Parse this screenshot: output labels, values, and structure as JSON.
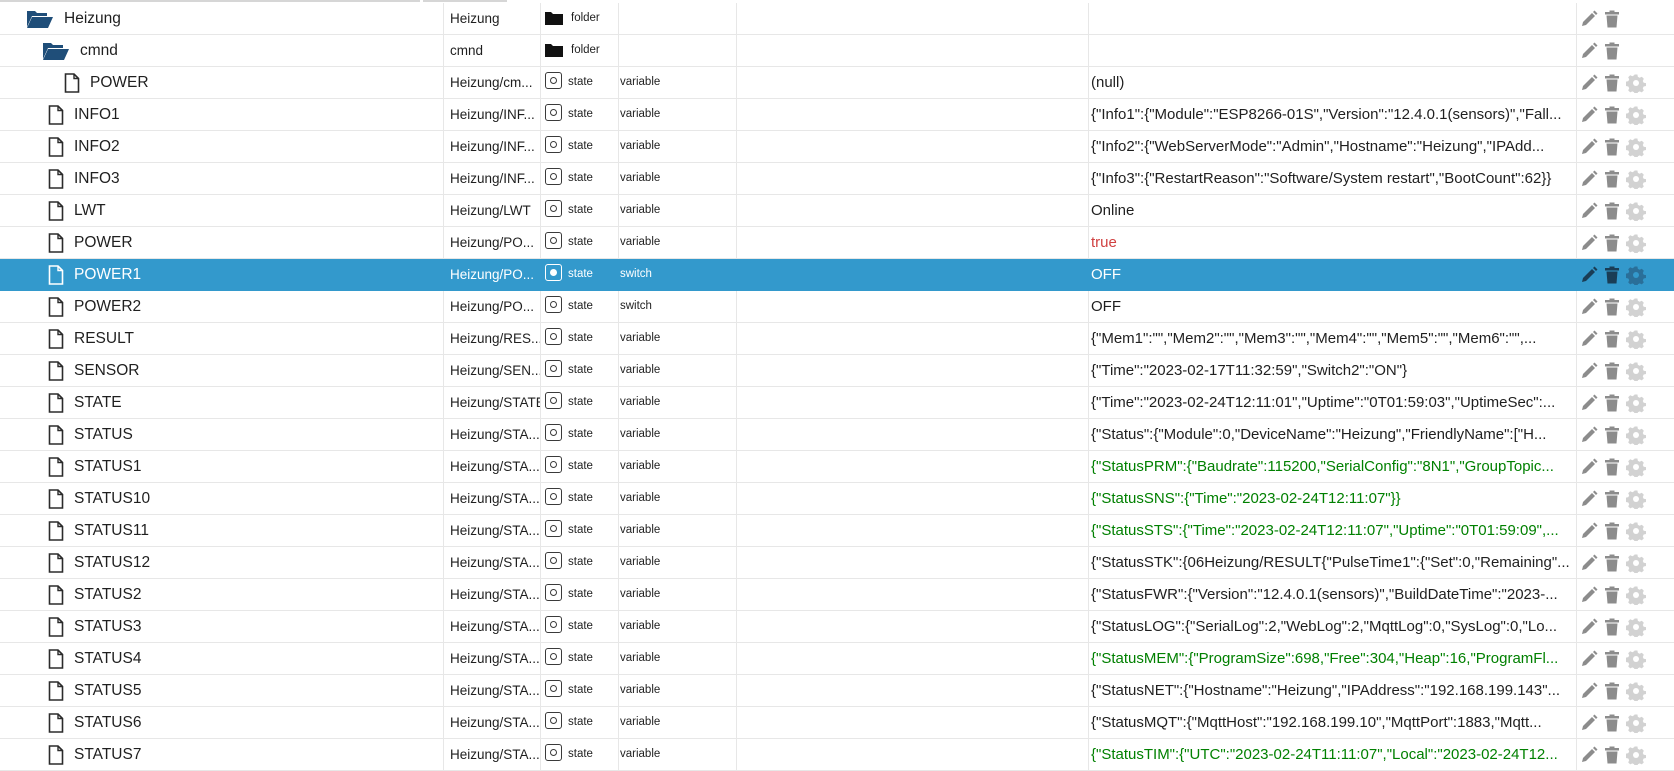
{
  "tree": {
    "rows": [
      {
        "name": "Heizung",
        "path": "Heizung",
        "type": "folder",
        "role": "",
        "value": "",
        "kind": "folder",
        "indent": 26,
        "value_color": "normal",
        "selected": false,
        "gear": false
      },
      {
        "name": "cmnd",
        "path": "cmnd",
        "type": "folder",
        "role": "",
        "value": "",
        "kind": "folder",
        "indent": 42,
        "value_color": "normal",
        "selected": false,
        "gear": false
      },
      {
        "name": "POWER",
        "path": "Heizung/cm...",
        "type": "state",
        "role": "variable",
        "value": "(null)",
        "kind": "file",
        "indent": 64,
        "value_color": "normal",
        "selected": false,
        "gear": true
      },
      {
        "name": "INFO1",
        "path": "Heizung/INF...",
        "type": "state",
        "role": "variable",
        "value": "{\"Info1\":{\"Module\":\"ESP8266-01S\",\"Version\":\"12.4.0.1(sensors)\",\"Fall...",
        "kind": "file",
        "indent": 48,
        "value_color": "normal",
        "selected": false,
        "gear": true
      },
      {
        "name": "INFO2",
        "path": "Heizung/INF...",
        "type": "state",
        "role": "variable",
        "value": "{\"Info2\":{\"WebServerMode\":\"Admin\",\"Hostname\":\"Heizung\",\"IPAdd...",
        "kind": "file",
        "indent": 48,
        "value_color": "normal",
        "selected": false,
        "gear": true
      },
      {
        "name": "INFO3",
        "path": "Heizung/INF...",
        "type": "state",
        "role": "variable",
        "value": "{\"Info3\":{\"RestartReason\":\"Software/System restart\",\"BootCount\":62}}",
        "kind": "file",
        "indent": 48,
        "value_color": "normal",
        "selected": false,
        "gear": true
      },
      {
        "name": "LWT",
        "path": "Heizung/LWT",
        "type": "state",
        "role": "variable",
        "value": "Online",
        "kind": "file",
        "indent": 48,
        "value_color": "normal",
        "selected": false,
        "gear": true
      },
      {
        "name": "POWER",
        "path": "Heizung/PO...",
        "type": "state",
        "role": "variable",
        "value": "true",
        "kind": "file",
        "indent": 48,
        "value_color": "red",
        "selected": false,
        "gear": true
      },
      {
        "name": "POWER1",
        "path": "Heizung/PO...",
        "type": "state",
        "role": "switch",
        "value": "OFF",
        "kind": "file",
        "indent": 48,
        "value_color": "normal",
        "selected": true,
        "gear": true
      },
      {
        "name": "POWER2",
        "path": "Heizung/PO...",
        "type": "state",
        "role": "switch",
        "value": "OFF",
        "kind": "file",
        "indent": 48,
        "value_color": "normal",
        "selected": false,
        "gear": true
      },
      {
        "name": "RESULT",
        "path": "Heizung/RES...",
        "type": "state",
        "role": "variable",
        "value": "{\"Mem1\":\"\",\"Mem2\":\"\",\"Mem3\":\"\",\"Mem4\":\"\",\"Mem5\":\"\",\"Mem6\":\"\",...",
        "kind": "file",
        "indent": 48,
        "value_color": "normal",
        "selected": false,
        "gear": true
      },
      {
        "name": "SENSOR",
        "path": "Heizung/SEN...",
        "type": "state",
        "role": "variable",
        "value": "{\"Time\":\"2023-02-17T11:32:59\",\"Switch2\":\"ON\"}",
        "kind": "file",
        "indent": 48,
        "value_color": "normal",
        "selected": false,
        "gear": true
      },
      {
        "name": "STATE",
        "path": "Heizung/STATE",
        "type": "state",
        "role": "variable",
        "value": "{\"Time\":\"2023-02-24T12:11:01\",\"Uptime\":\"0T01:59:03\",\"UptimeSec\":...",
        "kind": "file",
        "indent": 48,
        "value_color": "normal",
        "selected": false,
        "gear": true
      },
      {
        "name": "STATUS",
        "path": "Heizung/STA...",
        "type": "state",
        "role": "variable",
        "value": "{\"Status\":{\"Module\":0,\"DeviceName\":\"Heizung\",\"FriendlyName\":[\"H...",
        "kind": "file",
        "indent": 48,
        "value_color": "normal",
        "selected": false,
        "gear": true
      },
      {
        "name": "STATUS1",
        "path": "Heizung/STA...",
        "type": "state",
        "role": "variable",
        "value": "{\"StatusPRM\":{\"Baudrate\":115200,\"SerialConfig\":\"8N1\",\"GroupTopic...",
        "kind": "file",
        "indent": 48,
        "value_color": "green",
        "selected": false,
        "gear": true
      },
      {
        "name": "STATUS10",
        "path": "Heizung/STA...",
        "type": "state",
        "role": "variable",
        "value": "{\"StatusSNS\":{\"Time\":\"2023-02-24T12:11:07\"}}",
        "kind": "file",
        "indent": 48,
        "value_color": "green",
        "selected": false,
        "gear": true
      },
      {
        "name": "STATUS11",
        "path": "Heizung/STA...",
        "type": "state",
        "role": "variable",
        "value": "{\"StatusSTS\":{\"Time\":\"2023-02-24T12:11:07\",\"Uptime\":\"0T01:59:09\",...",
        "kind": "file",
        "indent": 48,
        "value_color": "green",
        "selected": false,
        "gear": true
      },
      {
        "name": "STATUS12",
        "path": "Heizung/STA...",
        "type": "state",
        "role": "variable",
        "value": "{\"StatusSTK\":{06Heizung/RESULT{\"PulseTime1\":{\"Set\":0,\"Remaining\"...",
        "kind": "file",
        "indent": 48,
        "value_color": "normal",
        "selected": false,
        "gear": true
      },
      {
        "name": "STATUS2",
        "path": "Heizung/STA...",
        "type": "state",
        "role": "variable",
        "value": "{\"StatusFWR\":{\"Version\":\"12.4.0.1(sensors)\",\"BuildDateTime\":\"2023-...",
        "kind": "file",
        "indent": 48,
        "value_color": "normal",
        "selected": false,
        "gear": true
      },
      {
        "name": "STATUS3",
        "path": "Heizung/STA...",
        "type": "state",
        "role": "variable",
        "value": "{\"StatusLOG\":{\"SerialLog\":2,\"WebLog\":2,\"MqttLog\":0,\"SysLog\":0,\"Lo...",
        "kind": "file",
        "indent": 48,
        "value_color": "normal",
        "selected": false,
        "gear": true
      },
      {
        "name": "STATUS4",
        "path": "Heizung/STA...",
        "type": "state",
        "role": "variable",
        "value": "{\"StatusMEM\":{\"ProgramSize\":698,\"Free\":304,\"Heap\":16,\"ProgramFl...",
        "kind": "file",
        "indent": 48,
        "value_color": "green",
        "selected": false,
        "gear": true
      },
      {
        "name": "STATUS5",
        "path": "Heizung/STA...",
        "type": "state",
        "role": "variable",
        "value": "{\"StatusNET\":{\"Hostname\":\"Heizung\",\"IPAddress\":\"192.168.199.143\"...",
        "kind": "file",
        "indent": 48,
        "value_color": "normal",
        "selected": false,
        "gear": true
      },
      {
        "name": "STATUS6",
        "path": "Heizung/STA...",
        "type": "state",
        "role": "variable",
        "value": "{\"StatusMQT\":{\"MqttHost\":\"192.168.199.10\",\"MqttPort\":1883,\"Mqtt...",
        "kind": "file",
        "indent": 48,
        "value_color": "normal",
        "selected": false,
        "gear": true
      },
      {
        "name": "STATUS7",
        "path": "Heizung/STA...",
        "type": "state",
        "role": "variable",
        "value": "{\"StatusTIM\":{\"UTC\":\"2023-02-24T11:11:07\",\"Local\":\"2023-02-24T12...",
        "kind": "file",
        "indent": 48,
        "value_color": "green",
        "selected": false,
        "gear": true
      }
    ]
  },
  "icons": {
    "folder_open": "folder-open-icon",
    "file": "file-icon",
    "folder_small": "folder-icon",
    "state": "state-icon",
    "edit": "pencil-icon",
    "delete": "trash-icon",
    "settings": "gear-icon"
  },
  "colors": {
    "selected_bg": "#3399cc",
    "folder_blue": "#1f4e79",
    "value_green": "#008000",
    "value_red": "#d04040"
  }
}
